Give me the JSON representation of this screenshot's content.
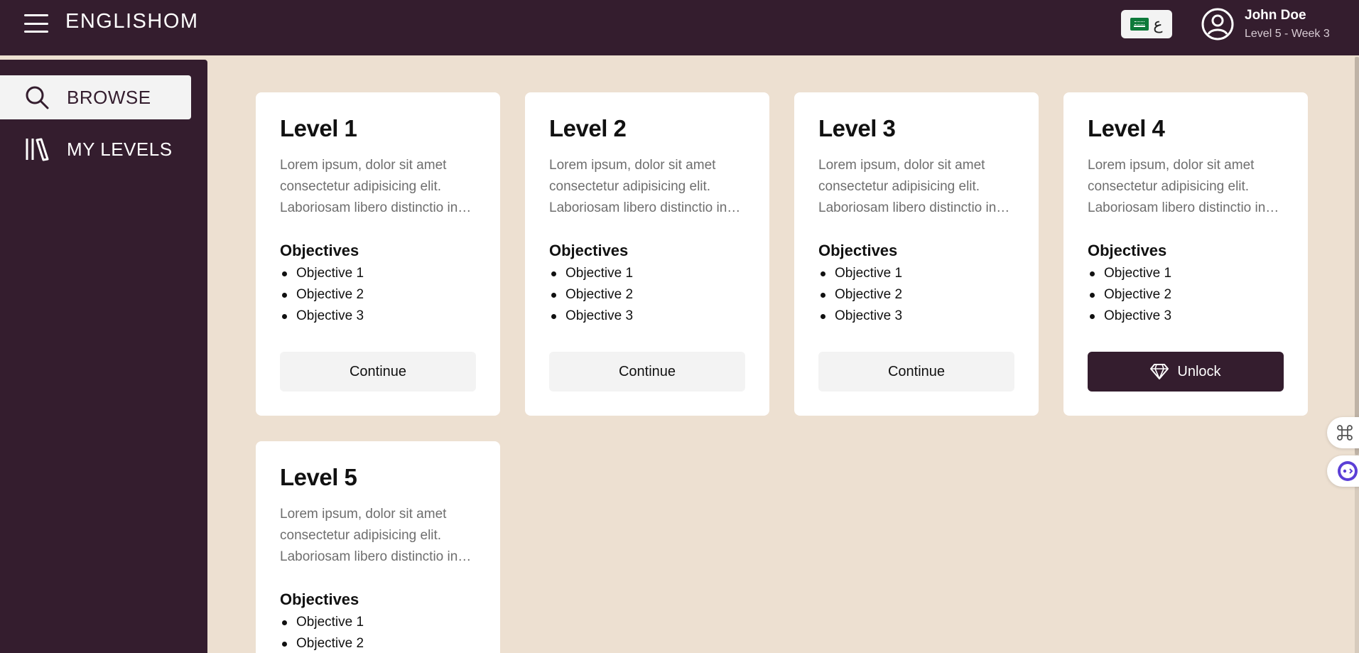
{
  "header": {
    "brand": "ENGLISHOM",
    "lang_code": "ع",
    "user_name": "John Doe",
    "user_level": "Level 5 - Week 3"
  },
  "sidebar": {
    "items": [
      {
        "label": "BROWSE",
        "icon": "search-icon",
        "active": true
      },
      {
        "label": "MY LEVELS",
        "icon": "library-icon",
        "active": false
      }
    ]
  },
  "levels": [
    {
      "title": "Level 1",
      "description": "Lorem ipsum, dolor sit amet consectetur adipisicing elit. Laboriosam libero distinctio in…",
      "objectives_title": "Objectives",
      "objectives": [
        "Objective 1",
        "Objective 2",
        "Objective 3"
      ],
      "button": "Continue"
    },
    {
      "title": "Level 2",
      "description": "Lorem ipsum, dolor sit amet consectetur adipisicing elit. Laboriosam libero distinctio in…",
      "objectives_title": "Objectives",
      "objectives": [
        "Objective 1",
        "Objective 2",
        "Objective 3"
      ],
      "button": "Continue"
    },
    {
      "title": "Level 3",
      "description": "Lorem ipsum, dolor sit amet consectetur adipisicing elit. Laboriosam libero distinctio in…",
      "objectives_title": "Objectives",
      "objectives": [
        "Objective 1",
        "Objective 2",
        "Objective 3"
      ],
      "button": "Continue"
    },
    {
      "title": "Level 4",
      "description": "Lorem ipsum, dolor sit amet consectetur adipisicing elit. Laboriosam libero distinctio in…",
      "objectives_title": "Objectives",
      "objectives": [
        "Objective 1",
        "Objective 2",
        "Objective 3"
      ],
      "button": "Unlock"
    },
    {
      "title": "Level 5",
      "description": "Lorem ipsum, dolor sit amet consectetur adipisicing elit. Laboriosam libero distinctio in…",
      "objectives_title": "Objectives",
      "objectives": [
        "Objective 1",
        "Objective 2"
      ]
    }
  ],
  "colors": {
    "primary": "#341d2e",
    "background": "#ede0d1",
    "card": "#ffffff",
    "button_light": "#f3f3f3"
  }
}
